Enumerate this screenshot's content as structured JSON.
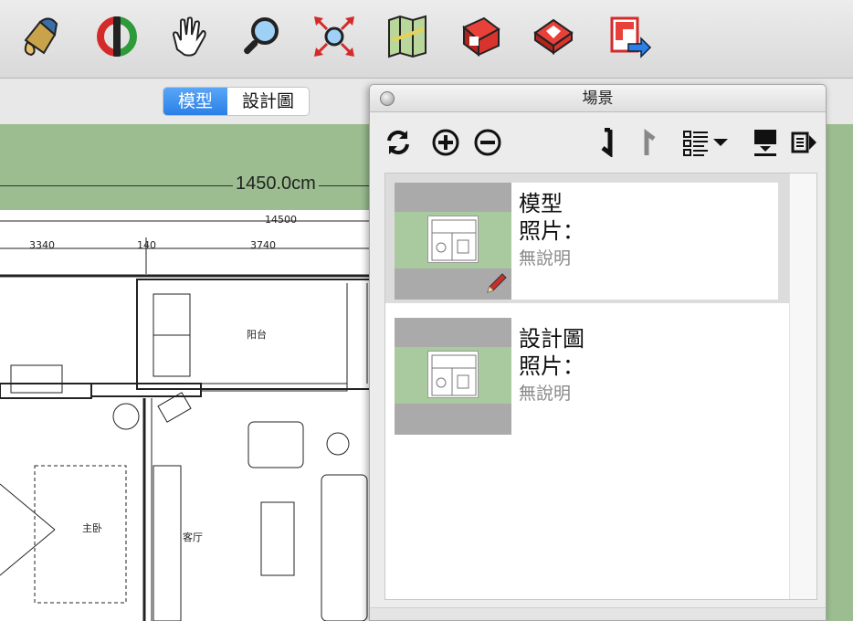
{
  "toolbar": {
    "icons": [
      "paint-bucket-icon",
      "orbit-icon",
      "pan-hand-icon",
      "zoom-icon",
      "zoom-extents-icon",
      "map-icon",
      "warehouse-icon",
      "extension-warehouse-icon",
      "send-to-layout-icon"
    ]
  },
  "tabs": {
    "model": "模型",
    "design": "設計圖"
  },
  "canvas": {
    "dimension_label": "1450.0cm"
  },
  "scenes_panel": {
    "title": "場景",
    "scenes": [
      {
        "name": "模型",
        "photo_label": "照片：",
        "description": "無說明",
        "selected": true
      },
      {
        "name": "設計圖",
        "photo_label": "照片：",
        "description": "無說明",
        "selected": false
      }
    ]
  },
  "colors": {
    "canvas_bg": "#9bbd8f",
    "tab_active": "#2a7fe8",
    "thumb_band": "#a9c99e"
  }
}
